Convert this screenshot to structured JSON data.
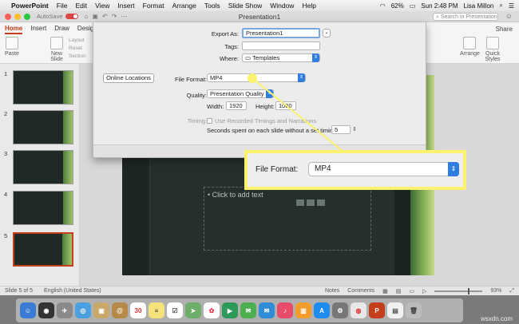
{
  "menubar": {
    "app_name": "PowerPoint",
    "items": [
      "File",
      "Edit",
      "View",
      "Insert",
      "Format",
      "Arrange",
      "Tools",
      "Slide Show",
      "Window",
      "Help"
    ],
    "battery": "62%",
    "clock": "Sun 2:48 PM",
    "user": "Lisa Millon"
  },
  "window": {
    "title": "Presentation1",
    "autosave_label": "AutoSave",
    "search_placeholder": "Search in Presentation"
  },
  "ribbon": {
    "tabs": [
      "Home",
      "Insert",
      "Draw",
      "Design"
    ],
    "share_label": "Share",
    "paste_label": "Paste",
    "new_slide_label": "New Slide",
    "layout_label": "Layout",
    "reset_label": "Reset",
    "section_label": "Section",
    "arrange_label": "Arrange",
    "quick_styles_label": "Quick Styles"
  },
  "thumbnails": [
    "1",
    "2",
    "3",
    "4",
    "5"
  ],
  "slide": {
    "placeholder_text": "Click to add text"
  },
  "dialog": {
    "export_as_label": "Export As:",
    "export_as_value": "Presentation1",
    "tags_label": "Tags:",
    "where_label": "Where:",
    "where_value": "Templates",
    "online_locations_label": "Online Locations",
    "file_format_label": "File Format:",
    "file_format_value": "MP4",
    "quality_label": "Quality:",
    "quality_value": "Presentation Quality",
    "width_label": "Width:",
    "width_value": "1920",
    "height_label": "Height:",
    "height_value": "1080",
    "timing_label": "Timing:",
    "timing_checkbox_label": "Use Recorded Timings and Narrations",
    "seconds_label": "Seconds spent on each slide without a set timing:",
    "seconds_value": "5"
  },
  "callout": {
    "label": "File Format:",
    "value": "MP4",
    "highlight_color": "#fdf26f"
  },
  "statusbar": {
    "slide_info": "Slide 5 of 5",
    "language": "English (United States)",
    "notes_label": "Notes",
    "comments_label": "Comments",
    "zoom": "93%"
  },
  "dock": {
    "calendar_day": "30",
    "watermark": "wsxdn.com"
  },
  "colors": {
    "accent": "#c43e1c",
    "select_blue": "#2f7de1",
    "slide_bg": "#25302b"
  }
}
